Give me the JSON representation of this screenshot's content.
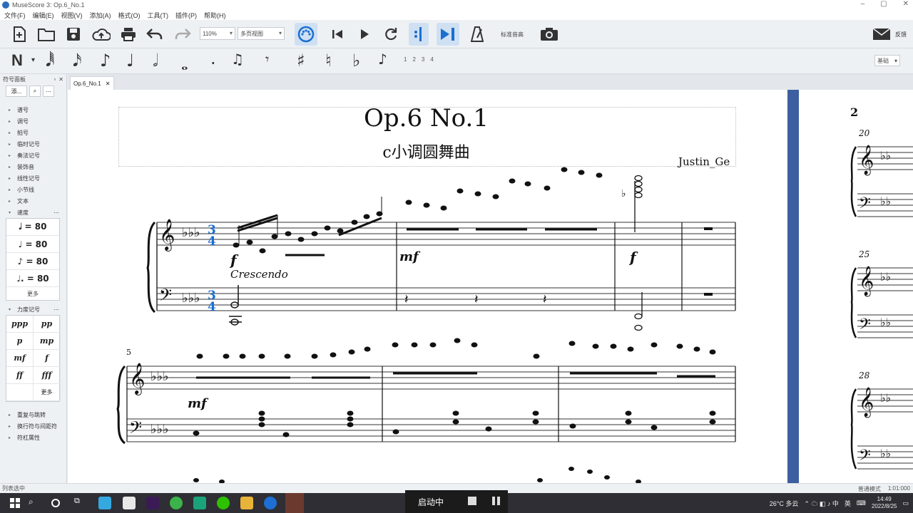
{
  "window": {
    "title": "MuseScore 3: Op.6_No.1",
    "controls": [
      "–",
      "▢",
      "✕"
    ]
  },
  "menu": [
    "文件(F)",
    "编辑(E)",
    "视图(V)",
    "添加(A)",
    "格式(O)",
    "工具(T)",
    "插件(P)",
    "帮助(H)"
  ],
  "toolbar": {
    "zoom": "110%",
    "view_mode": "多页视图",
    "concert_pitch": "标准音高",
    "feedback": "反馈"
  },
  "note_input": {
    "mode_label": "N",
    "voices": [
      "1",
      "2",
      "3",
      "4"
    ],
    "relative_select": "基础"
  },
  "palette": {
    "header": "符号面板",
    "add_button": "添...",
    "sections_top": [
      "谱号",
      "调号",
      "拍号",
      "临时记号",
      "奏法记号",
      "装饰音",
      "线性记号",
      "小节线",
      "文本"
    ],
    "tempo_section": "速度",
    "tempo_items": [
      "𝅗𝅥 = 80",
      "♩ = 80",
      "♪ = 80",
      "♩. = 80"
    ],
    "tempo_more": "更多",
    "dynamics_section": "力度记号",
    "dynamics_items": [
      "ppp",
      "pp",
      "p",
      "mp",
      "mf",
      "f",
      "ff",
      "fff"
    ],
    "dynamics_more": "更多",
    "sections_bottom": [
      "重复与跳转",
      "换行符与间距符",
      "符杠属性"
    ]
  },
  "score_tab": {
    "label": "Op.6_No.1"
  },
  "score": {
    "title": "Op.6 No.1",
    "subtitle": "c小调圆舞曲",
    "composer": "Justin_Ge",
    "time_signature_top": "3",
    "time_signature_bottom": "4",
    "crescendo": "Crescendo",
    "dyn_m1": "f",
    "dyn_m2": "mf",
    "dyn_m3": "f",
    "dyn_m5": "mf",
    "measure_number_row2": "5",
    "next_page_number": "2",
    "next_page_measures": [
      "20",
      "25",
      "28"
    ],
    "tempo_marking_hidden": "",
    "accent_color": "#1a6fd1"
  },
  "status": {
    "left": "列表选中",
    "mode": "普通模式",
    "time": "1:01:000"
  },
  "taskbar": {
    "recording_label": "启动中",
    "weather": "26°C 多云",
    "ime": "英",
    "time": "14:49",
    "date": "2022/8/25"
  }
}
